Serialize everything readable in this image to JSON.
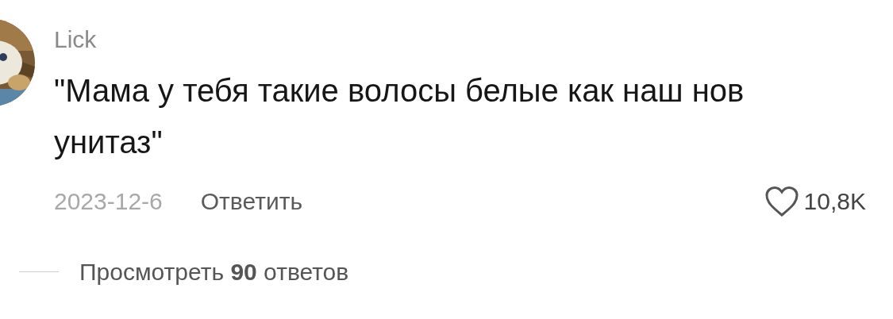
{
  "comment": {
    "author": "Lick",
    "text": "\"Мама у тебя такие волосы белые как наш нов\nунитаз\"",
    "date": "2023-12-6",
    "reply": "Ответить",
    "liked": false,
    "likes": "10,8K",
    "replies": "Просмотреть **90** ответов"
  }
}
